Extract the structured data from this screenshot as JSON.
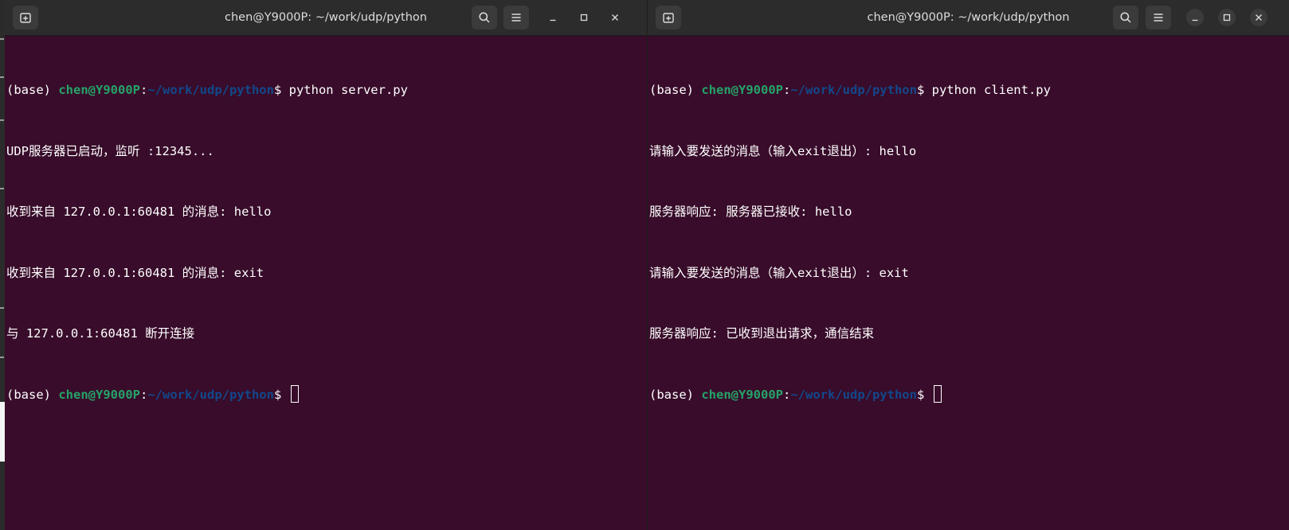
{
  "colors": {
    "terminal_bg": "#380c2a",
    "titlebar_bg": "#2c2c2c",
    "prompt_user": "#26a269",
    "prompt_path": "#12488b",
    "text": "#ffffff"
  },
  "icons": {
    "new_tab": "new-tab-icon",
    "search": "search-icon",
    "menu": "hamburger-menu-icon",
    "minimize": "minimize-icon",
    "maximize": "maximize-icon",
    "close": "close-icon"
  },
  "windows": [
    {
      "title": "chen@Y9000P: ~/work/udp/python",
      "lines": [
        {
          "prefix": "(base) ",
          "user": "chen@Y9000P",
          "colon": ":",
          "path": "~/work/udp/python",
          "tail": "$ python server.py"
        },
        {
          "text": "UDP服务器已启动，监听 :12345..."
        },
        {
          "text": "收到来自 127.0.0.1:60481 的消息: hello"
        },
        {
          "text": "收到来自 127.0.0.1:60481 的消息: exit"
        },
        {
          "text": "与 127.0.0.1:60481 断开连接"
        },
        {
          "prefix": "(base) ",
          "user": "chen@Y9000P",
          "colon": ":",
          "path": "~/work/udp/python",
          "tail": "$ "
        }
      ]
    },
    {
      "title": "chen@Y9000P: ~/work/udp/python",
      "lines": [
        {
          "prefix": "(base) ",
          "user": "chen@Y9000P",
          "colon": ":",
          "path": "~/work/udp/python",
          "tail": "$ python client.py"
        },
        {
          "text": "请输入要发送的消息（输入exit退出）: hello"
        },
        {
          "text": "服务器响应: 服务器已接收: hello"
        },
        {
          "text": "请输入要发送的消息（输入exit退出）: exit"
        },
        {
          "text": "服务器响应: 已收到退出请求，通信结束"
        },
        {
          "prefix": "(base) ",
          "user": "chen@Y9000P",
          "colon": ":",
          "path": "~/work/udp/python",
          "tail": "$ "
        }
      ]
    }
  ]
}
